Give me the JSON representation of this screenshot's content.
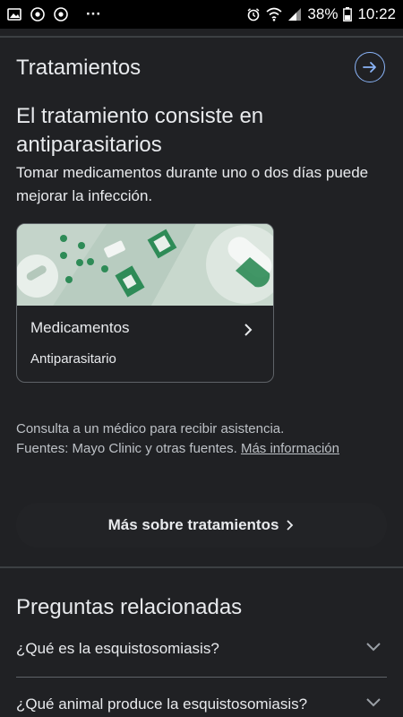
{
  "status_bar": {
    "notification_icons": [
      "image-icon",
      "chrome-icon",
      "chrome-icon"
    ],
    "more": "···",
    "battery": "38%",
    "time": "10:22"
  },
  "treatments": {
    "section_title": "Tratamientos",
    "headline": "El tratamiento consiste en antiparasitarios",
    "description": "Tomar medicamentos durante uno o dos días puede mejorar la infección.",
    "card": {
      "title": "Medicamentos",
      "subtitle": "Antiparasitario"
    },
    "note_line1": "Consulta a un médico para recibir asistencia.",
    "note_sources": "Fuentes: Mayo Clinic y otras fuentes.",
    "note_link": "Más información",
    "more_button": "Más sobre tratamientos"
  },
  "related": {
    "title": "Preguntas relacionadas",
    "questions": [
      "¿Qué es la esquistosomiasis?",
      "¿Qué animal produce la esquistosomiasis?"
    ]
  },
  "colors": {
    "background": "#202124",
    "accent_blue": "#8ab4f8",
    "illustration_green": "#3a9e6a"
  }
}
